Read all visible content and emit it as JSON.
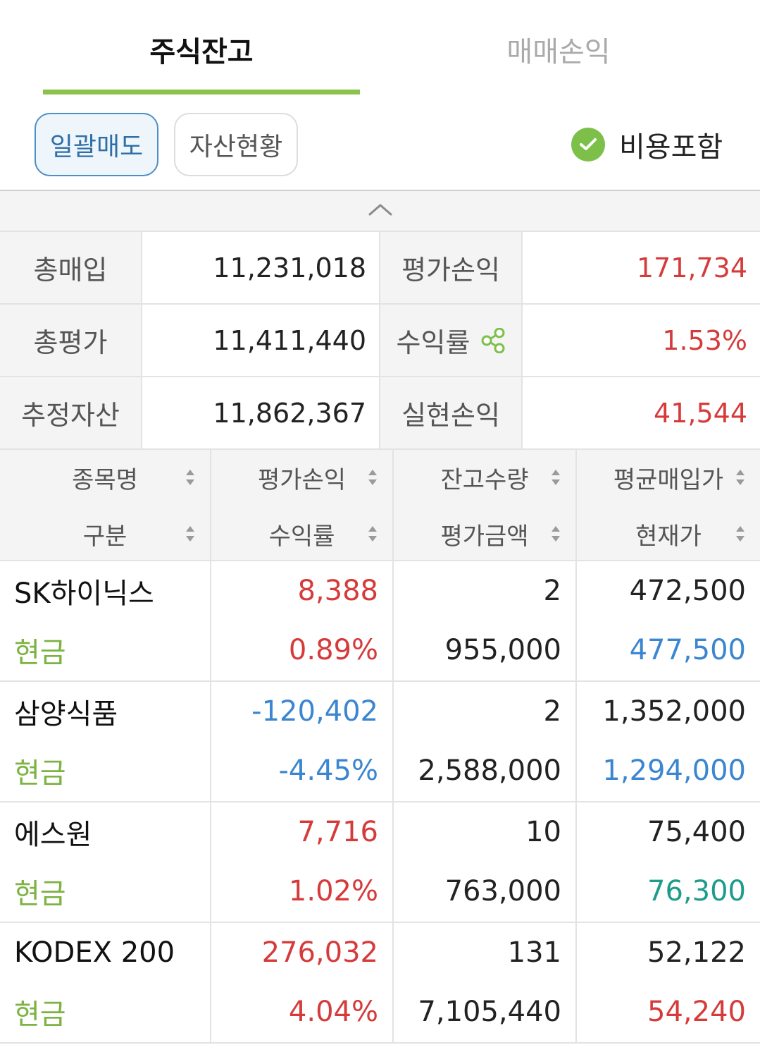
{
  "tabs": [
    {
      "label": "주식잔고",
      "active": true
    },
    {
      "label": "매매손익",
      "active": false
    }
  ],
  "toolbar": {
    "bulk_sell_label": "일괄매도",
    "asset_status_label": "자산현황",
    "include_cost_label": "비용포함",
    "include_cost_checked": true
  },
  "summary": [
    {
      "label1": "총매입",
      "value1": "11,231,018",
      "label2": "평가손익",
      "value2": "171,734"
    },
    {
      "label1": "총평가",
      "value1": "11,411,440",
      "label2": "수익률",
      "value2": "1.53%"
    },
    {
      "label1": "추정자산",
      "value1": "11,862,367",
      "label2": "실현손익",
      "value2": "41,544"
    }
  ],
  "table_header": [
    {
      "top": "종목명",
      "bottom": "구분"
    },
    {
      "top": "평가손익",
      "bottom": "수익률"
    },
    {
      "top": "잔고수량",
      "bottom": "평가금액"
    },
    {
      "top": "평균매입가",
      "bottom": "현재가"
    }
  ],
  "holdings": [
    {
      "name": "SK하이닉스",
      "type": "현금",
      "pl": "8,388",
      "rate": "0.89%",
      "qty": "2",
      "eval": "955,000",
      "avg": "472,500",
      "cur": "477,500"
    },
    {
      "name": "삼양식품",
      "type": "현금",
      "pl": "-120,402",
      "rate": "-4.45%",
      "qty": "2",
      "eval": "2,588,000",
      "avg": "1,352,000",
      "cur": "1,294,000"
    },
    {
      "name": "에스원",
      "type": "현금",
      "pl": "7,716",
      "rate": "1.02%",
      "qty": "10",
      "eval": "763,000",
      "avg": "75,400",
      "cur": "76,300"
    },
    {
      "name": "KODEX 200",
      "type": "현금",
      "pl": "276,032",
      "rate": "4.04%",
      "qty": "131",
      "eval": "7,105,440",
      "avg": "52,122",
      "cur": "54,240"
    }
  ],
  "colors": {
    "accent_green": "#8bc34a",
    "profit_red": "#d63b3b",
    "loss_blue": "#3b86d0",
    "flat_teal": "#1d9c8a"
  },
  "icons": {
    "collapse": "chevron-up-icon",
    "check": "check-circle-icon",
    "share": "share-icon",
    "sort": "sort-icon"
  }
}
